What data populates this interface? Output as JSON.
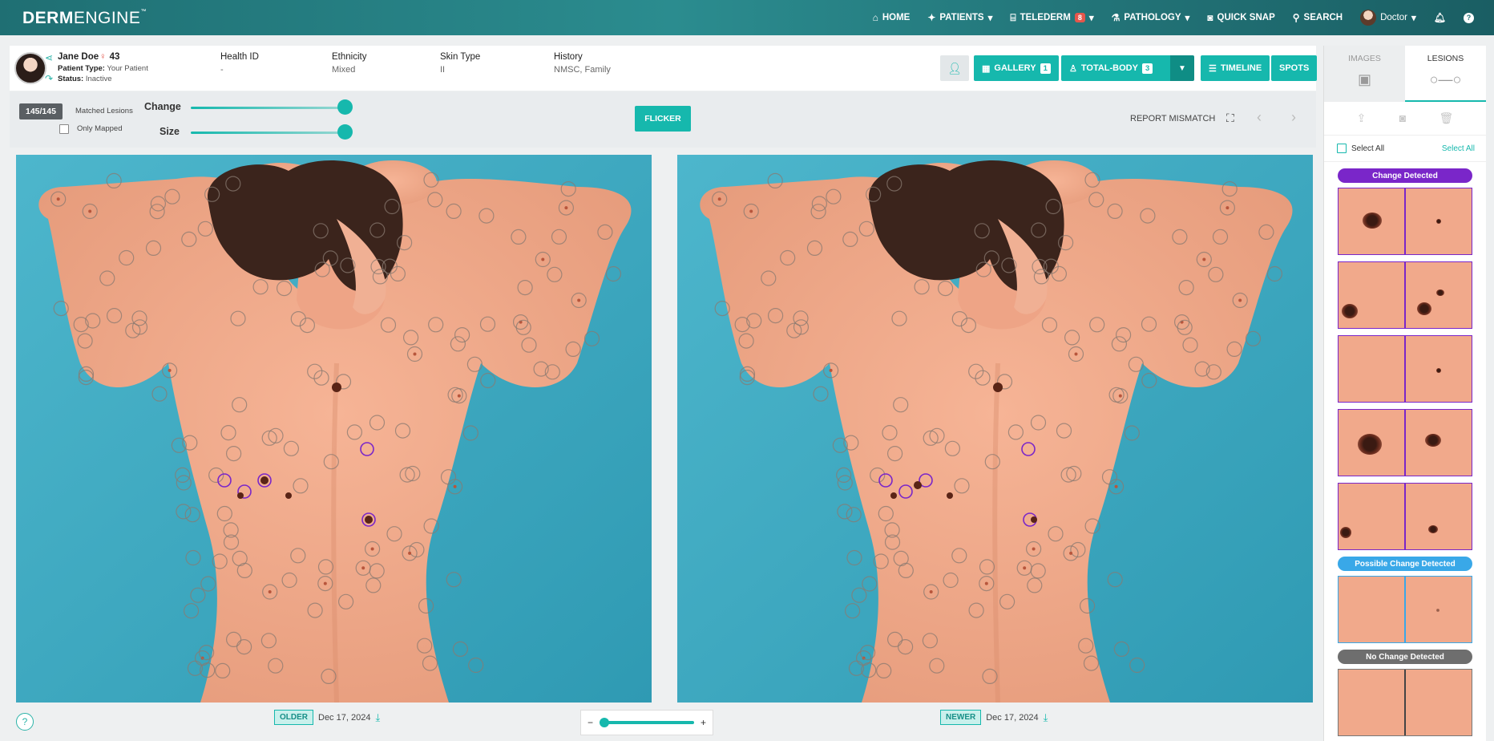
{
  "nav": {
    "brand_bold": "DERM",
    "brand_thin": "ENGINE",
    "brand_tm": "™",
    "items": [
      {
        "label": "HOME",
        "icon": "home-icon"
      },
      {
        "label": "PATIENTS",
        "icon": "patients-icon",
        "caret": "▾"
      },
      {
        "label": "TELEDERM",
        "icon": "telederm-icon",
        "badge": "8",
        "caret": "▾"
      },
      {
        "label": "PATHOLOGY",
        "icon": "pathology-icon",
        "caret": "▾"
      },
      {
        "label": "QUICK SNAP",
        "icon": "camera-icon"
      },
      {
        "label": "SEARCH",
        "icon": "search-icon"
      },
      {
        "label": "Doctor",
        "icon": "user-avatar",
        "caret": "▾"
      },
      {
        "label": "",
        "icon": "bell-icon"
      },
      {
        "label": "",
        "icon": "help-icon"
      }
    ]
  },
  "patient": {
    "name": "Jane Doe",
    "age": "43",
    "type_label": "Patient Type:",
    "type_value": "Your Patient",
    "status_label": "Status:",
    "status_value": "Inactive",
    "fields": [
      {
        "label": "Health ID",
        "value": "-"
      },
      {
        "label": "Ethnicity",
        "value": "Mixed"
      },
      {
        "label": "Skin Type",
        "value": "II"
      },
      {
        "label": "History",
        "value": "NMSC, Family"
      }
    ]
  },
  "toolbar": {
    "gallery_label": "GALLERY",
    "gallery_count": "1",
    "totalbody_label": "TOTAL-BODY",
    "totalbody_count": "3",
    "timeline_label": "TIMELINE",
    "spots_label": "SPOTS"
  },
  "controls": {
    "matched_count": "145/145",
    "matched_label": "Matched Lesions",
    "only_mapped_label": "Only Mapped",
    "change_label": "Change",
    "size_label": "Size",
    "change_level": 1.0,
    "size_level": 1.0,
    "flicker_label": "FLICKER",
    "report_label": "REPORT MISMATCH"
  },
  "panes": {
    "older_tag": "OLDER",
    "older_date": "Dec 17, 2024",
    "newer_tag": "NEWER",
    "newer_date": "Dec 17, 2024",
    "zoom_minus": "−",
    "zoom_plus": "+",
    "zoom_level": 0.0
  },
  "sidebar": {
    "tab_images": "IMAGES",
    "tab_lesions": "LESIONS",
    "select_all_left": "Select All",
    "select_all_right": "Select All",
    "group_change": "Change Detected",
    "group_possible": "Possible Change Detected",
    "group_nochange": "No Change Detected",
    "colors": {
      "change": "#7a26c9",
      "possible": "#39a8e8",
      "nochange": "#6e6e6e"
    }
  },
  "colors": {
    "accent": "#16b8ad",
    "nav_bg": "#1f6f73"
  }
}
